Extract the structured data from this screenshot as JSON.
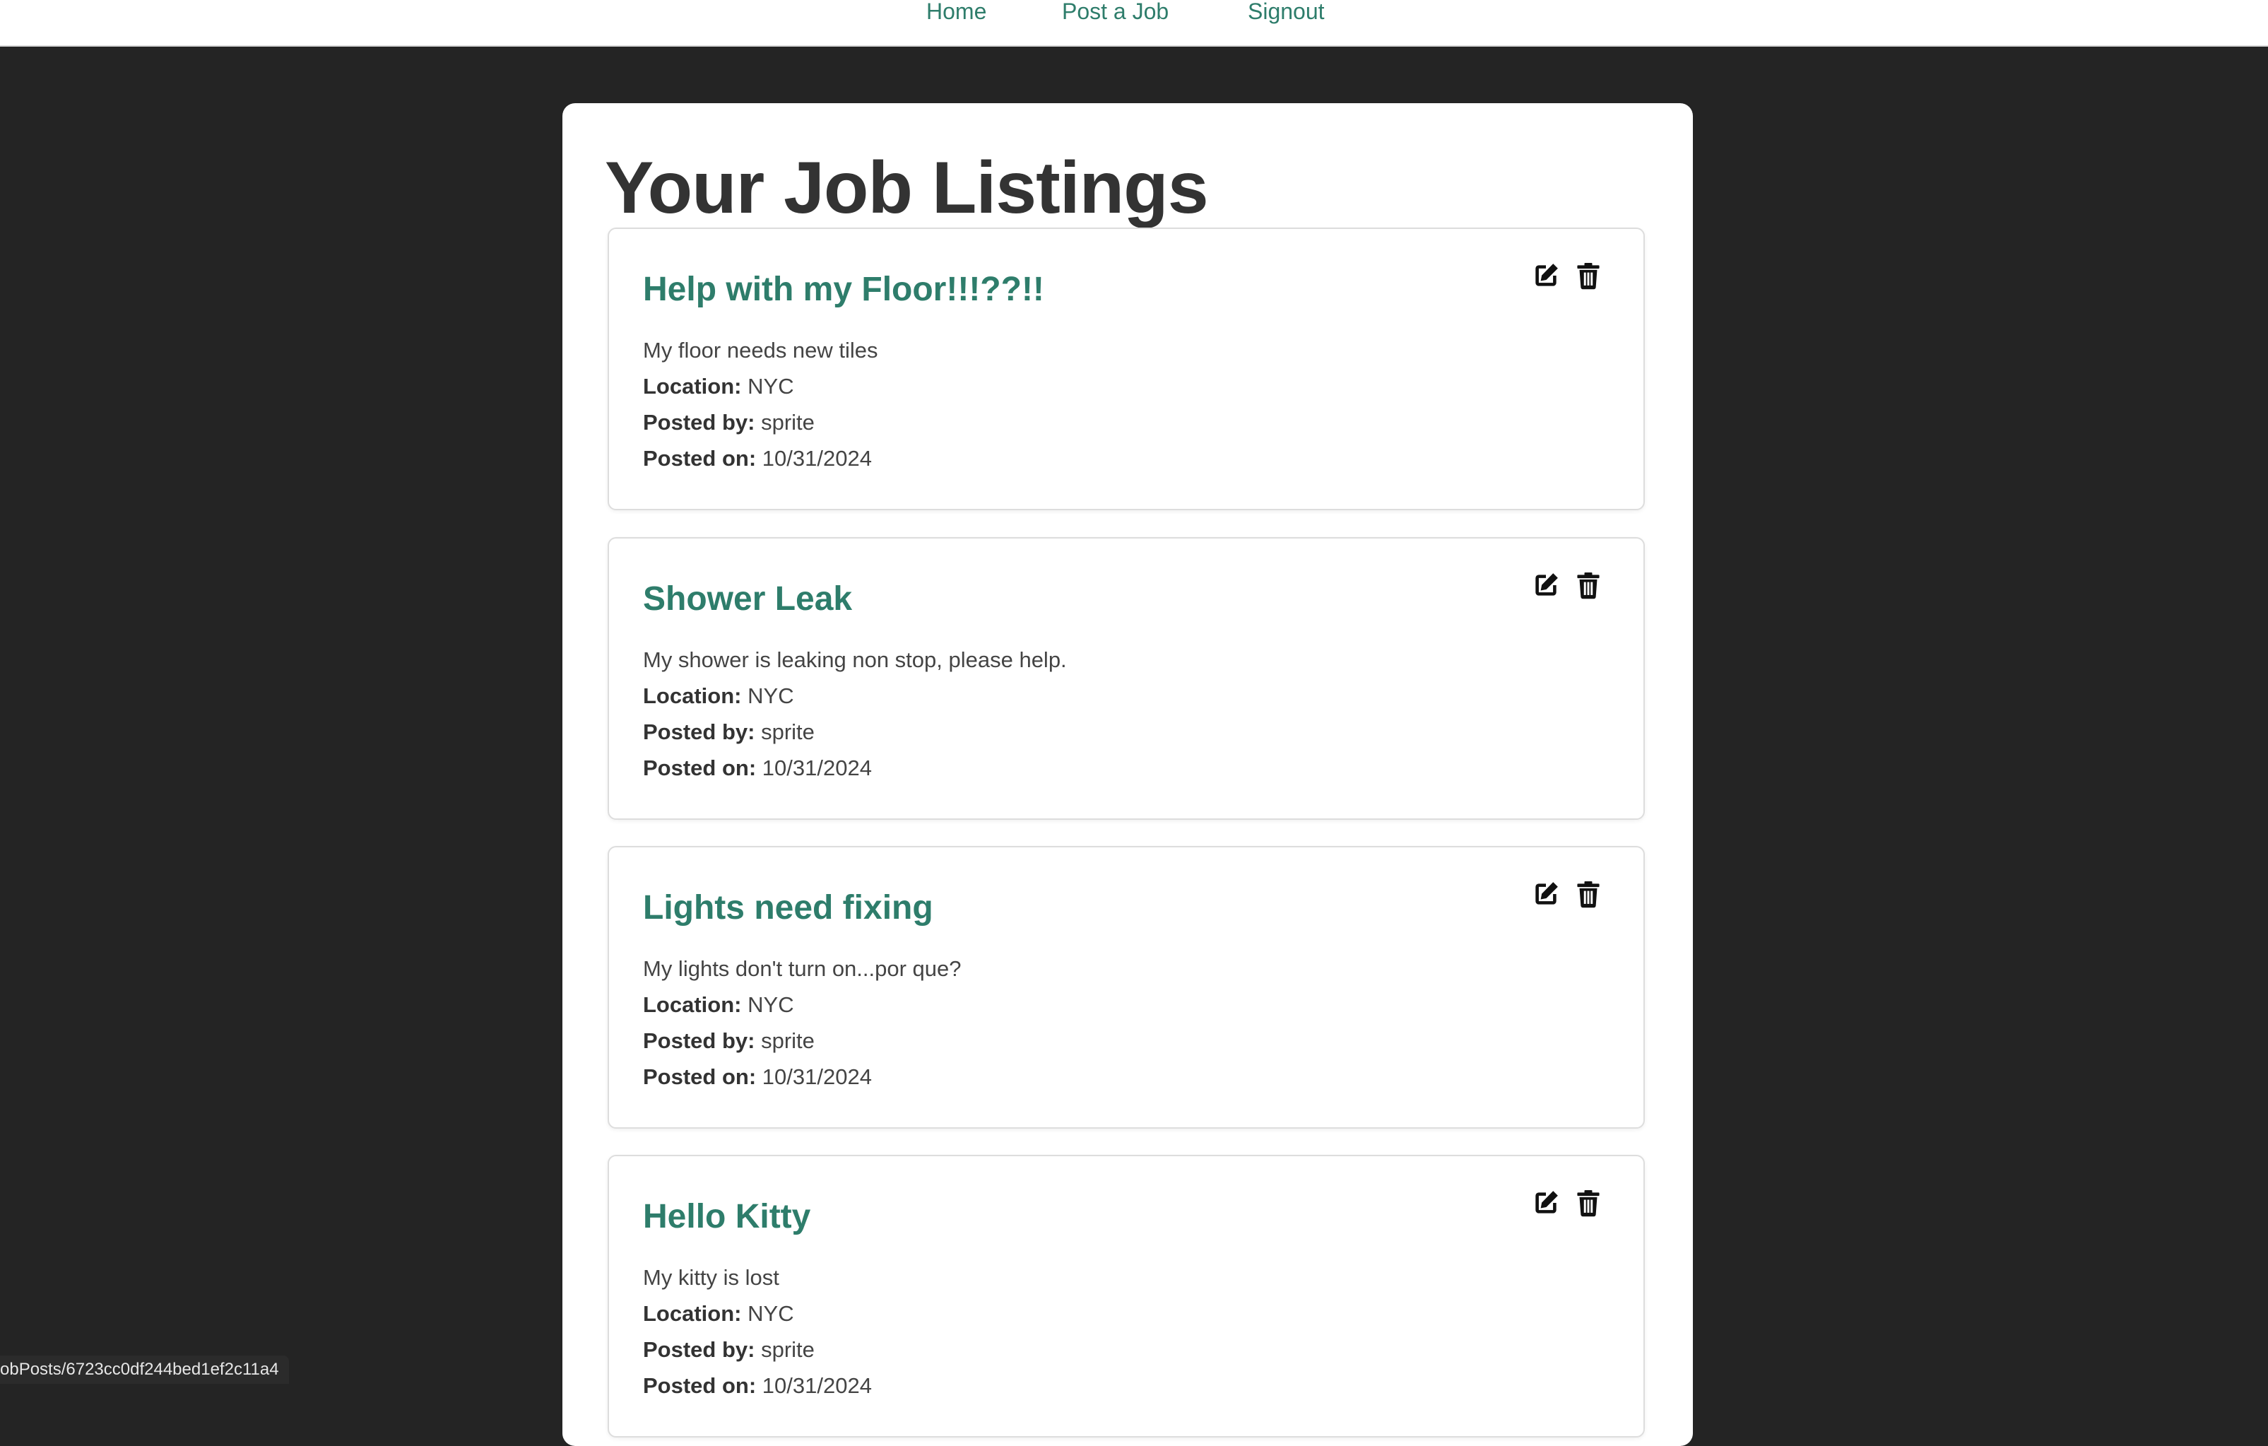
{
  "nav": {
    "items": [
      {
        "label": "Home"
      },
      {
        "label": "Post a Job"
      },
      {
        "label": "Signout"
      }
    ]
  },
  "page": {
    "title": "Your Job Listings"
  },
  "labels": {
    "location": "Location:",
    "posted_by": "Posted by:",
    "posted_on": "Posted on:"
  },
  "jobs": [
    {
      "title": "Help with my Floor!!!??!!",
      "description": "My floor needs new tiles",
      "location": "NYC",
      "posted_by": "sprite",
      "posted_on": "10/31/2024"
    },
    {
      "title": "Shower Leak",
      "description": "My shower is leaking non stop, please help.",
      "location": "NYC",
      "posted_by": "sprite",
      "posted_on": "10/31/2024"
    },
    {
      "title": "Lights need fixing",
      "description": "My lights don't turn on...por que?",
      "location": "NYC",
      "posted_by": "sprite",
      "posted_on": "10/31/2024"
    },
    {
      "title": "Hello Kitty",
      "description": "My kitty is lost",
      "location": "NYC",
      "posted_by": "sprite",
      "posted_on": "10/31/2024"
    }
  ],
  "status_bar": {
    "url": "obPosts/6723cc0df244bed1ef2c11a4"
  },
  "icons": {
    "edit": "edit-icon",
    "delete": "trash-icon"
  },
  "colors": {
    "accent": "#2e7d6b",
    "background": "#242424",
    "panel": "#ffffff"
  }
}
